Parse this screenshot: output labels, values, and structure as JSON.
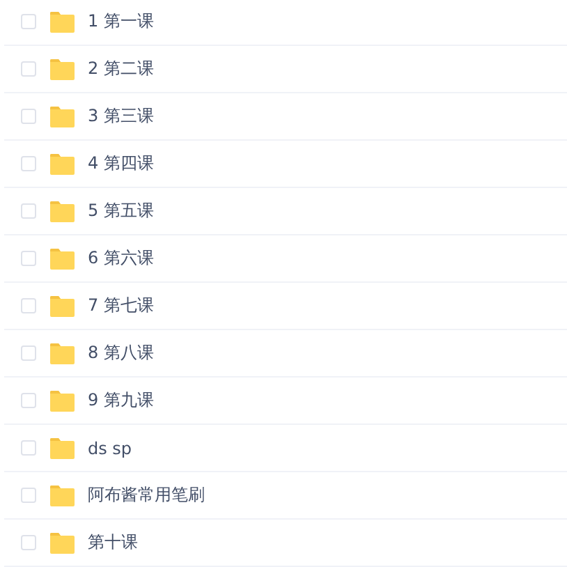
{
  "files": [
    {
      "name": "1 第一课",
      "checked": false
    },
    {
      "name": "2 第二课",
      "checked": false
    },
    {
      "name": "3 第三课",
      "checked": false
    },
    {
      "name": "4 第四课",
      "checked": false
    },
    {
      "name": "5 第五课",
      "checked": false
    },
    {
      "name": "6 第六课",
      "checked": false
    },
    {
      "name": "7 第七课",
      "checked": false
    },
    {
      "name": "8 第八课",
      "checked": false
    },
    {
      "name": "9 第九课",
      "checked": false
    },
    {
      "name": "ds sp",
      "checked": false
    },
    {
      "name": "阿布酱常用笔刷",
      "checked": false
    },
    {
      "name": "第十课",
      "checked": false
    }
  ]
}
